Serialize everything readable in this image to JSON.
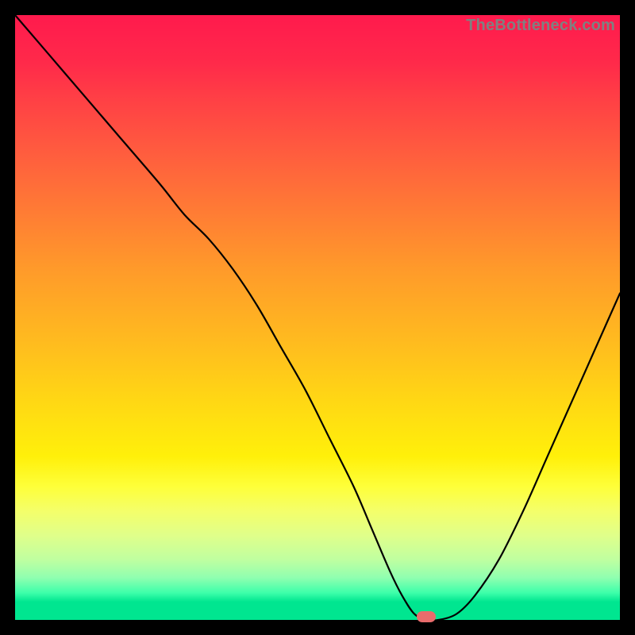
{
  "watermark": "TheBottleneck.com",
  "colors": {
    "page_bg": "#000000",
    "curve": "#000000",
    "marker": "#e86c6c",
    "gradient_top": "#ff1a4d",
    "gradient_bottom": "#00e690"
  },
  "chart_data": {
    "type": "line",
    "title": "",
    "xlabel": "",
    "ylabel": "",
    "xlim": [
      0,
      100
    ],
    "ylim": [
      0,
      100
    ],
    "series": [
      {
        "name": "bottleneck-curve",
        "x": [
          0,
          6,
          12,
          18,
          24,
          28,
          32,
          36,
          40,
          44,
          48,
          52,
          56,
          59,
          62,
          64,
          66,
          68,
          70,
          73,
          76,
          80,
          84,
          88,
          92,
          96,
          100
        ],
        "y": [
          100,
          93,
          86,
          79,
          72,
          67,
          63,
          58,
          52,
          45,
          38,
          30,
          22,
          15,
          8,
          4,
          1,
          0,
          0,
          1,
          4,
          10,
          18,
          27,
          36,
          45,
          54
        ]
      }
    ],
    "marker": {
      "x": 68,
      "y": 0
    },
    "grid": false,
    "legend": false
  }
}
